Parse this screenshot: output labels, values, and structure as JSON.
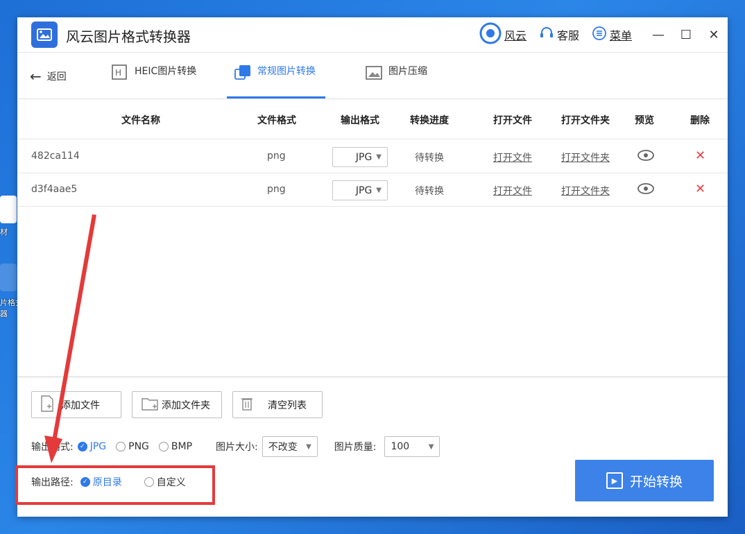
{
  "app": {
    "title": "风云图片格式转换器",
    "actions": {
      "fengyun": "风云",
      "service": "客服",
      "menu": "菜单"
    },
    "window_controls": {
      "minimize": "—",
      "maximize": "☐",
      "close": "✕"
    }
  },
  "desktop": {
    "icon_labels": [
      "材",
      "片格式",
      "器"
    ]
  },
  "nav": {
    "back": "返回",
    "tabs": [
      {
        "label": "HEIC图片转换",
        "icon": "heic-icon",
        "active": false
      },
      {
        "label": "常规图片转换",
        "icon": "convert-icon",
        "active": true
      },
      {
        "label": "图片压缩",
        "icon": "zip-image-icon",
        "active": false
      }
    ]
  },
  "table": {
    "headers": [
      "文件名称",
      "文件格式",
      "输出格式",
      "转换进度",
      "打开文件",
      "打开文件夹",
      "预览",
      "删除"
    ],
    "rows": [
      {
        "name": "482ca114",
        "format": "png",
        "output": "JPG",
        "progress": "待转换",
        "open_file": "打开文件",
        "open_folder": "打开文件夹"
      },
      {
        "name": "d3f4aae5",
        "format": "png",
        "output": "JPG",
        "progress": "待转换",
        "open_file": "打开文件",
        "open_folder": "打开文件夹"
      }
    ]
  },
  "buttons": {
    "add_file": "添加文件",
    "add_folder": "添加文件夹",
    "clear_list": "清空列表"
  },
  "output_format": {
    "label": "输出格式:",
    "options": [
      "JPG",
      "PNG",
      "BMP"
    ],
    "selected": "JPG"
  },
  "image_size": {
    "label": "图片大小:",
    "value": "不改变"
  },
  "image_quality": {
    "label": "图片质量:",
    "value": "100"
  },
  "output_path": {
    "label": "输出路径:",
    "options": [
      "原目录",
      "自定义"
    ],
    "selected": "原目录"
  },
  "start_button": "开始转换",
  "colors": {
    "accent": "#2f79e8",
    "start_button": "#3c82e8",
    "delete": "#e84040",
    "annotation": "#e43a3a",
    "desktop": "#1e6fd6"
  }
}
